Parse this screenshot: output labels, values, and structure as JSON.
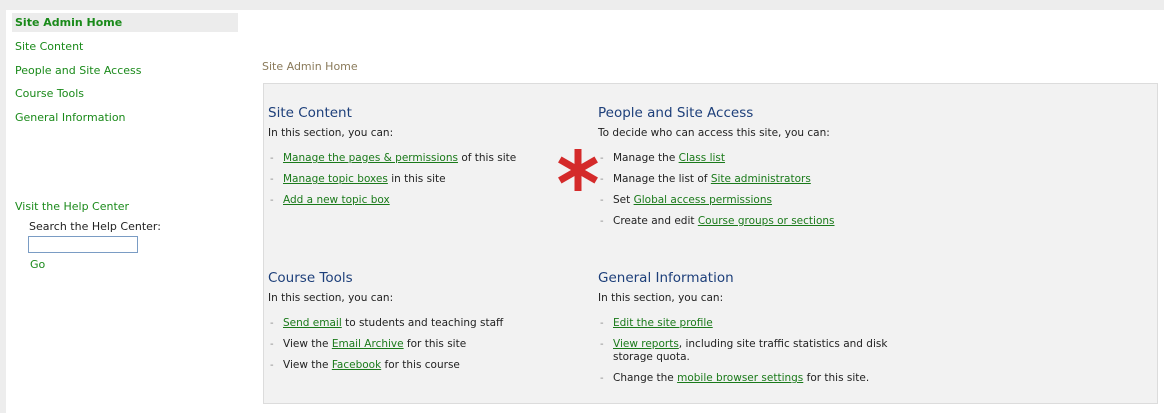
{
  "sidebar": {
    "items": [
      {
        "label": "Site Admin Home",
        "active": true
      },
      {
        "label": "Site Content"
      },
      {
        "label": "People and Site Access"
      },
      {
        "label": "Course Tools"
      },
      {
        "label": "General Information"
      }
    ],
    "help_link": "Visit the Help Center",
    "search_label": "Search the Help Center:",
    "search_value": "",
    "go_label": "Go"
  },
  "breadcrumb": "Site Admin Home",
  "sections": {
    "site_content": {
      "title": "Site Content",
      "intro": "In this section, you can:",
      "items": [
        {
          "link": "Manage the pages & permissions",
          "after": " of this site"
        },
        {
          "link": "Manage topic boxes",
          "after": " in this site"
        },
        {
          "link": "Add a new topic box",
          "after": ""
        }
      ]
    },
    "people": {
      "title": "People and Site Access",
      "intro": "To decide who can access this site, you can:",
      "items": [
        {
          "before": "Manage the ",
          "link": "Class list"
        },
        {
          "before": "Manage the list of ",
          "link": "Site administrators"
        },
        {
          "before": "Set ",
          "link": "Global access permissions"
        },
        {
          "before": "Create and edit ",
          "link": "Course groups or sections"
        }
      ]
    },
    "course_tools": {
      "title": "Course Tools",
      "intro": "In this section, you can:",
      "items": [
        {
          "before": "",
          "link": "Send email",
          "after": " to students and teaching staff"
        },
        {
          "before": "View the ",
          "link": "Email Archive",
          "after": " for this site"
        },
        {
          "before": "View the ",
          "link": "Facebook",
          "after": " for this course"
        }
      ]
    },
    "general_info": {
      "title": "General Information",
      "intro": "In this section, you can:",
      "items": [
        {
          "before": "",
          "link": "Edit the site profile",
          "after": ""
        },
        {
          "before": "",
          "link": "View reports",
          "after": ", including site traffic statistics and disk storage quota."
        },
        {
          "before": "Change the ",
          "link": "mobile browser settings",
          "after": " for this site."
        }
      ]
    }
  },
  "bullet_glyph": "-",
  "colors": {
    "link": "#1a7a1a",
    "heading": "#1d3f7a",
    "asterisk": "#d42a2a"
  }
}
